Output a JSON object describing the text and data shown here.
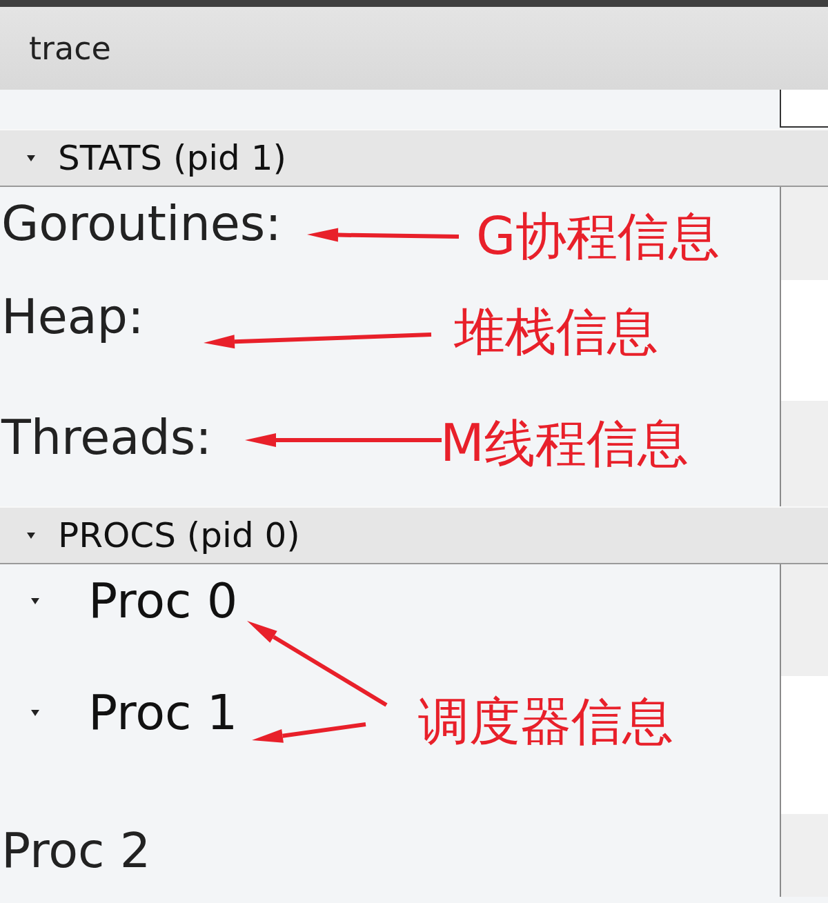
{
  "title": "trace",
  "sections": [
    {
      "title": "STATS (pid 1)",
      "expanded": true,
      "tracks": [
        {
          "label": "Goroutines:",
          "kind": "plain"
        },
        {
          "label": "Heap:",
          "kind": "plain"
        },
        {
          "label": "Threads:",
          "kind": "plain"
        }
      ]
    },
    {
      "title": "PROCS (pid 0)",
      "expanded": true,
      "tracks": [
        {
          "label": "Proc 0",
          "kind": "group",
          "expanded": true
        },
        {
          "label": "Proc 1",
          "kind": "group",
          "expanded": true
        },
        {
          "label": "Proc 2",
          "kind": "plain"
        }
      ]
    }
  ],
  "annotations": [
    {
      "text": "G协程信息"
    },
    {
      "text": "堆栈信息"
    },
    {
      "text": "M线程信息"
    },
    {
      "text": "调度器信息"
    }
  ]
}
